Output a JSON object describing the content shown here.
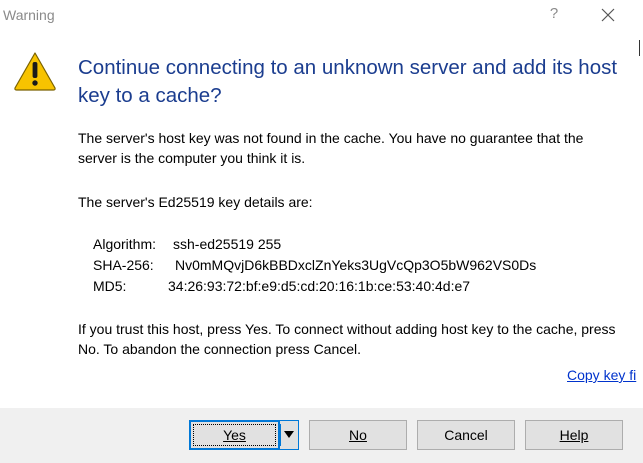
{
  "window": {
    "title": "Warning",
    "help_glyph": "?",
    "close_icon": "close-icon"
  },
  "dialog": {
    "icon": "warning-icon",
    "heading": "Continue connecting to an unknown server and add its host key to a cache?",
    "paragraph1": "The server's host key was not found in the cache. You have no guarantee that the server is the computer you think it is.",
    "paragraph2": "The server's Ed25519 key details are:",
    "details": [
      {
        "label": "Algorithm:",
        "value": "ssh-ed25519 255"
      },
      {
        "label": "SHA-256:",
        "value": "Nv0mMQvjD6kBBDxclZnYeks3UgVcQp3O5bW962VS0Ds"
      },
      {
        "label": "MD5:",
        "value": "34:26:93:72:bf:e9:d5:cd:20:16:1b:ce:53:40:4d:e7"
      }
    ],
    "paragraph3": "If you trust this host, press Yes. To connect without adding host key to the cache, press No. To abandon the connection press Cancel.",
    "copy_link": "Copy key fi"
  },
  "buttons": {
    "yes": "Yes",
    "no": "No",
    "cancel": "Cancel",
    "help": "Help"
  },
  "colors": {
    "heading": "#1b3d8f",
    "link": "#0033cc",
    "focus_border": "#0078d7",
    "footer_bg": "#f0f0f0",
    "warning_yellow": "#f7c300"
  }
}
